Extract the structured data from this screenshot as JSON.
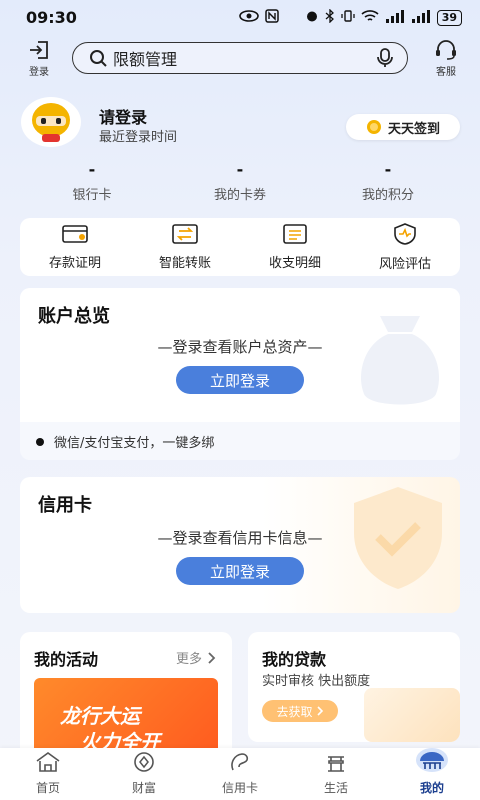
{
  "status_bar": {
    "time": "09:30",
    "battery": "39"
  },
  "header": {
    "login_label": "登录",
    "search_text": "限额管理",
    "service_label": "客服"
  },
  "profile": {
    "title": "请登录",
    "subtitle": "最近登录时间",
    "signin_label": "天天签到"
  },
  "stats": [
    {
      "value": "-",
      "label": "银行卡"
    },
    {
      "value": "-",
      "label": "我的卡券"
    },
    {
      "value": "-",
      "label": "我的积分"
    }
  ],
  "quick_actions": [
    {
      "label": "存款证明",
      "icon": "deposit-certificate-icon"
    },
    {
      "label": "智能转账",
      "icon": "transfer-icon"
    },
    {
      "label": "收支明细",
      "icon": "statement-icon"
    },
    {
      "label": "风险评估",
      "icon": "risk-assessment-icon"
    }
  ],
  "account": {
    "title": "账户总览",
    "hint": "—登录查看账户总资产—",
    "button": "立即登录",
    "pay_note": "微信/支付宝支付，一键多绑"
  },
  "credit": {
    "title": "信用卡",
    "hint": "—登录查看信用卡信息—",
    "button": "立即登录"
  },
  "activity": {
    "title": "我的活动",
    "more": "更多",
    "banner_line1": "龙行大运",
    "banner_line2": "火力全开"
  },
  "loan": {
    "title": "我的贷款",
    "subtitle": "实时审核 快出额度",
    "button": "去获取"
  },
  "nav": [
    {
      "label": "首页",
      "icon": "home-icon"
    },
    {
      "label": "财富",
      "icon": "wealth-icon"
    },
    {
      "label": "信用卡",
      "icon": "credit-card-icon"
    },
    {
      "label": "生活",
      "icon": "life-icon"
    },
    {
      "label": "我的",
      "icon": "profile-icon",
      "active": true
    }
  ],
  "colors": {
    "accent": "#4a7fdc",
    "nav_active": "#1c3f8f",
    "banner": "#ff6a22",
    "loan_button": "#ffc173"
  }
}
